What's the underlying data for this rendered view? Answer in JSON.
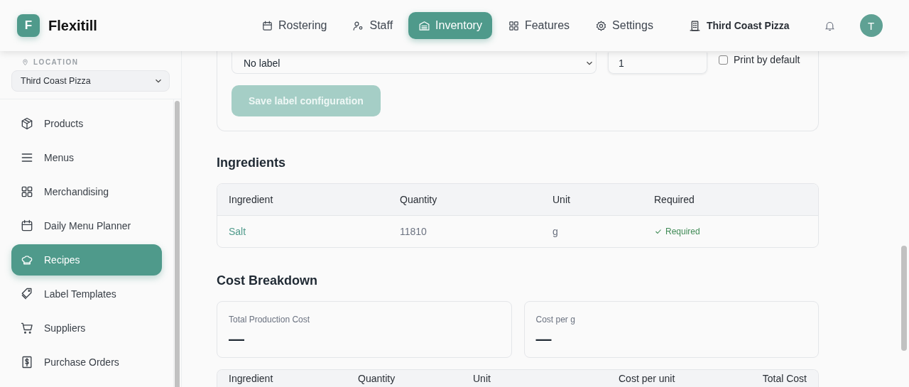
{
  "brand": {
    "initial": "F",
    "name": "Flexitill"
  },
  "nav": [
    {
      "label": "Rostering",
      "selected": false
    },
    {
      "label": "Staff",
      "selected": false
    },
    {
      "label": "Inventory",
      "selected": true
    },
    {
      "label": "Features",
      "selected": false
    },
    {
      "label": "Settings",
      "selected": false
    }
  ],
  "business": "Third Coast Pizza",
  "avatar": "T",
  "sidebar": {
    "location_label": "LOCATION",
    "location_value": "Third Coast Pizza",
    "items": [
      {
        "label": "Products",
        "selected": false
      },
      {
        "label": "Menus",
        "selected": false
      },
      {
        "label": "Merchandising",
        "selected": false
      },
      {
        "label": "Daily Menu Planner",
        "selected": false
      },
      {
        "label": "Recipes",
        "selected": true
      },
      {
        "label": "Label Templates",
        "selected": false
      },
      {
        "label": "Suppliers",
        "selected": false
      },
      {
        "label": "Purchase Orders",
        "selected": false
      }
    ]
  },
  "label_config": {
    "template": "No label",
    "copies": "1",
    "print_by_default": {
      "label": "Print by default",
      "checked": false
    },
    "save_button": {
      "label": "Save label configuration",
      "disabled": true
    }
  },
  "ingredients": {
    "title": "Ingredients",
    "columns": [
      "Ingredient",
      "Quantity",
      "Unit",
      "Required"
    ],
    "rows": [
      {
        "ingredient": "Salt",
        "quantity": "11810",
        "unit": "g",
        "required": {
          "label": "Required",
          "checked": true
        }
      }
    ]
  },
  "cost_breakdown": {
    "title": "Cost Breakdown",
    "stats": [
      {
        "label": "Total Production Cost",
        "value": "—"
      },
      {
        "label": "Cost per g",
        "value": "—"
      }
    ],
    "columns": [
      "Ingredient",
      "Quantity",
      "Unit",
      "Cost per unit",
      "Total Cost"
    ]
  }
}
